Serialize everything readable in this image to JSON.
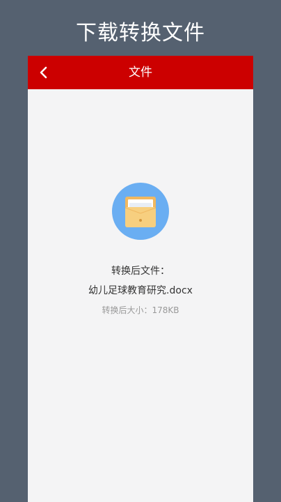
{
  "banner": {
    "title": "下载转换文件"
  },
  "nav": {
    "title": "文件",
    "back_icon": "chevron-left-icon"
  },
  "file": {
    "icon": "folder-envelope-icon",
    "label": "转换后文件：",
    "name": "幼儿足球教育研究.docx",
    "size_text": "转换后大小：178KB"
  },
  "colors": {
    "background": "#556170",
    "nav_bar": "#cc0000",
    "icon_circle": "#6aaef2",
    "panel": "#f4f4f5"
  }
}
